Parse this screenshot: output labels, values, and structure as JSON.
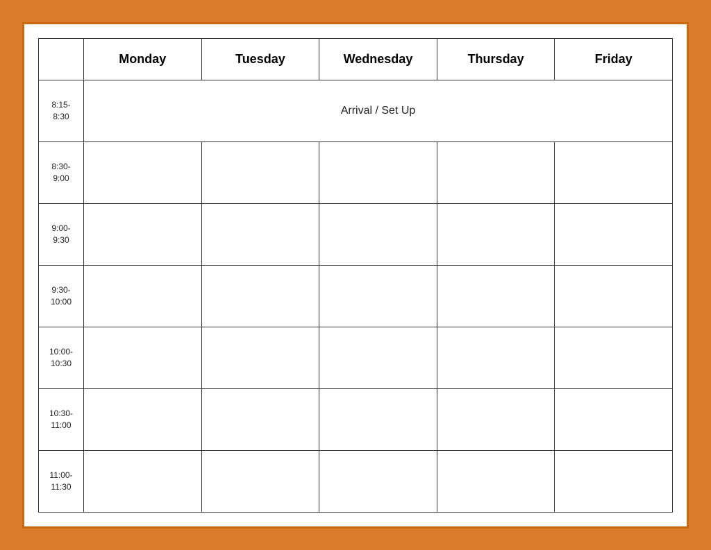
{
  "table": {
    "headers": [
      "",
      "Monday",
      "Tuesday",
      "Wednesday",
      "Thursday",
      "Friday"
    ],
    "arrival_label": "Arrival / Set Up",
    "time_slots": [
      {
        "label": "8:15-\n8:30",
        "is_arrival": true
      },
      {
        "label": "8:30-\n9:00",
        "is_arrival": false
      },
      {
        "label": "9:00-\n9:30",
        "is_arrival": false
      },
      {
        "label": "9:30-\n10:00",
        "is_arrival": false
      },
      {
        "label": "10:00-\n10:30",
        "is_arrival": false
      },
      {
        "label": "10:30-\n11:00",
        "is_arrival": false
      },
      {
        "label": "11:00-\n11:30",
        "is_arrival": false
      }
    ]
  }
}
